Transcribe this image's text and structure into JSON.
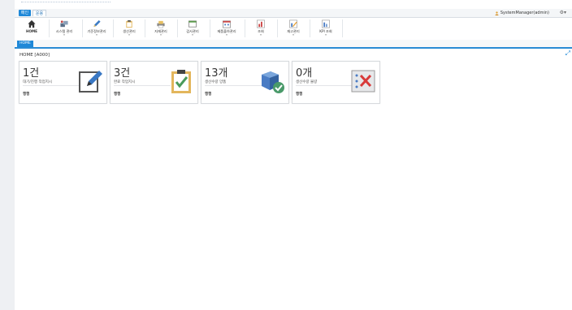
{
  "menubar": {
    "tabs": [
      {
        "label": "메인"
      },
      {
        "label": "운용"
      }
    ],
    "user": "SystemManager(admin)"
  },
  "toolbar": {
    "items": [
      {
        "label": "HOME",
        "icon": "home-icon"
      },
      {
        "label": "시스템 관리",
        "icon": "system-admin-icon"
      },
      {
        "label": "기준정보관리",
        "icon": "pencil-icon"
      },
      {
        "label": "생산관리",
        "icon": "clipboard-icon"
      },
      {
        "label": "자재관리",
        "icon": "printer-icon"
      },
      {
        "label": "검사관리",
        "icon": "window-icon"
      },
      {
        "label": "제품출하관리",
        "icon": "calendar-icon"
      },
      {
        "label": "조회",
        "icon": "chart-icon"
      },
      {
        "label": "재고관리",
        "icon": "chart-pencil-icon"
      },
      {
        "label": "KPI 조회",
        "icon": "kpi-chart-icon"
      }
    ]
  },
  "hometab": {
    "label": "HOME"
  },
  "breadcrumb": "HOME [A000]",
  "cards": [
    {
      "value": "1건",
      "desc": "대기/진행 작업지시",
      "link": "행행",
      "icon": "edit-icon"
    },
    {
      "value": "3건",
      "desc": "완료 작업지시",
      "link": "행행",
      "icon": "clipboard-check-icon"
    },
    {
      "value": "13개",
      "desc": "생산수량 양품",
      "link": "행행",
      "icon": "box-check-icon"
    },
    {
      "value": "0개",
      "desc": "생산수량 불량",
      "link": "행행",
      "icon": "defect-x-icon"
    }
  ],
  "colors": {
    "accent": "#1e88d8",
    "card_border": "#d7dadd"
  }
}
